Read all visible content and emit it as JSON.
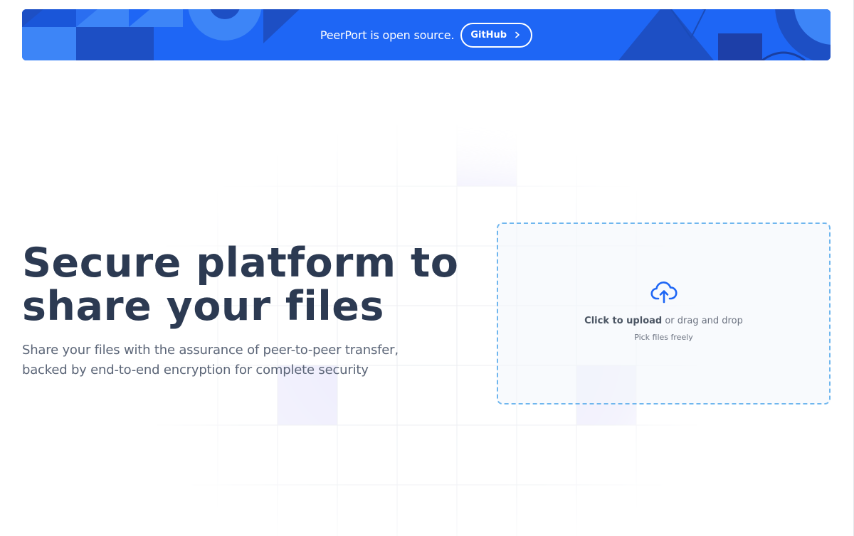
{
  "banner": {
    "text": "PeerPort is open source.",
    "button_label": "GitHub",
    "button_icon": "chevron-right-icon",
    "colors": {
      "background": "#1e66f5",
      "shape_dark": "#1d4fc4",
      "shape_light": "#3d85f7"
    }
  },
  "hero": {
    "title_line1": "Secure platform to",
    "title_line2": "share your files",
    "subtitle_line1": "Share your files with the assurance of peer-to-peer transfer,",
    "subtitle_line2": "backed by end-to-end encryption for complete security"
  },
  "upload": {
    "icon": "cloud-upload-icon",
    "action_strong": "Click to upload",
    "action_rest": " or drag and drop",
    "hint": "Pick files freely"
  },
  "theme": {
    "title_color": "#2c3a52",
    "accent": "#1e66f5",
    "dropzone_border": "#6fb6ee"
  }
}
